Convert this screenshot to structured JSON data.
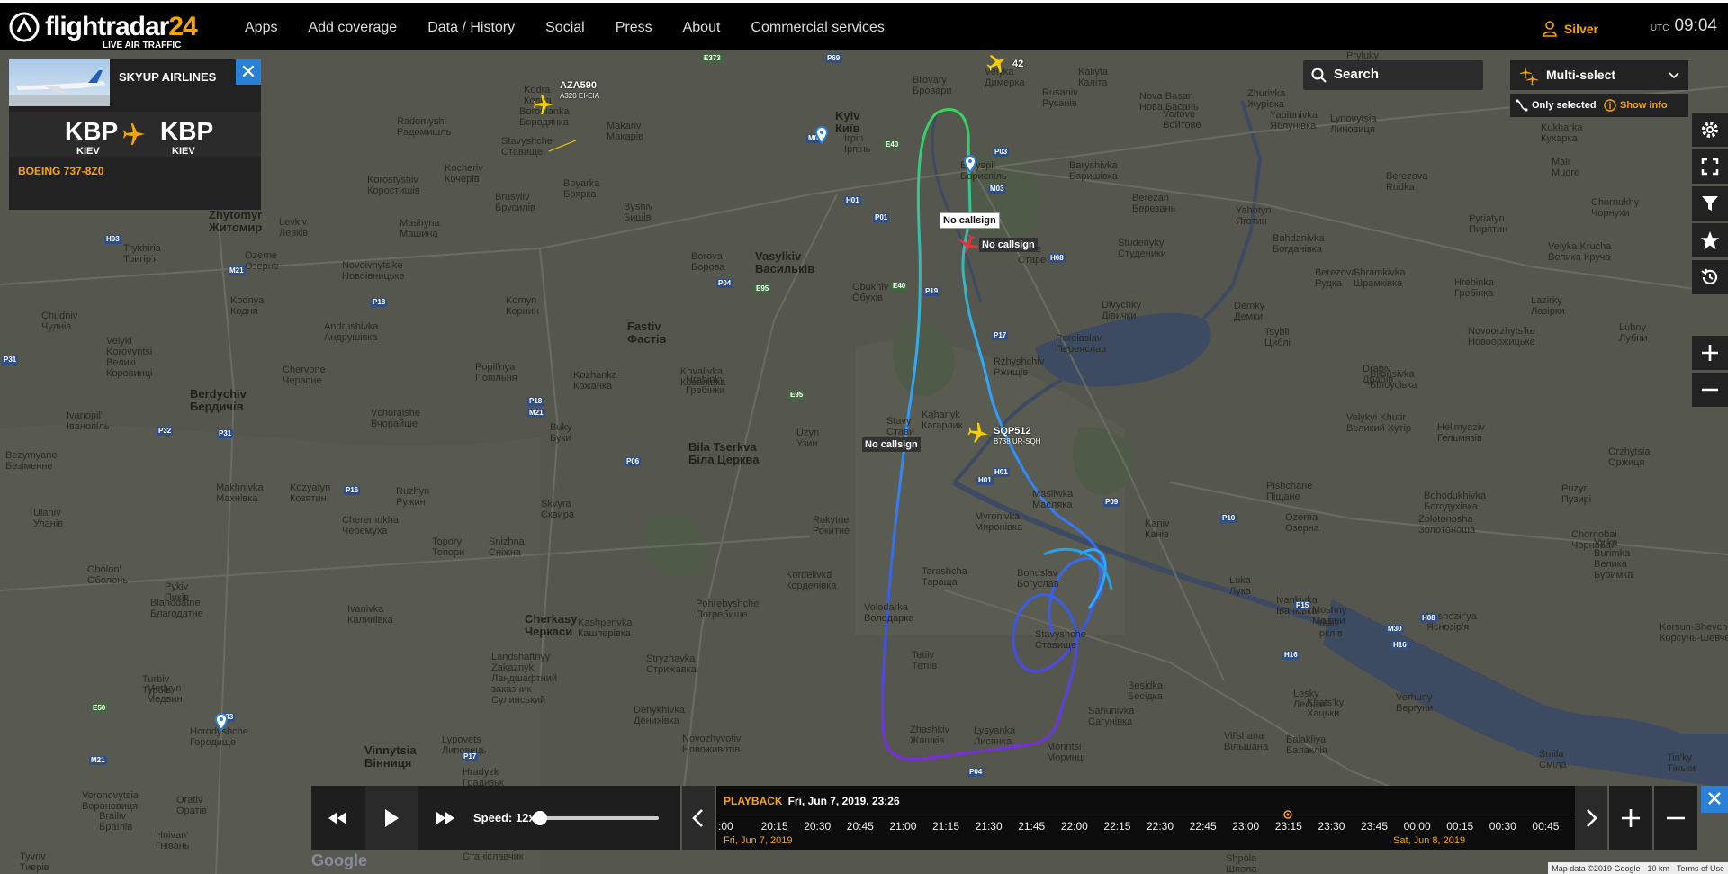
{
  "brand": {
    "name": "flightradar",
    "num": "24",
    "tagline": "LIVE AIR TRAFFIC"
  },
  "nav": [
    "Apps",
    "Add coverage",
    "Data / History",
    "Social",
    "Press",
    "About",
    "Commercial services"
  ],
  "user": {
    "level": "Silver"
  },
  "clock": {
    "zone": "UTC",
    "time": "09:04"
  },
  "flight_panel": {
    "airline": "SKYUP AIRLINES",
    "origin_code": "KBP",
    "origin_city": "KIEV",
    "dest_code": "KBP",
    "dest_city": "KIEV",
    "aircraft": "BOEING 737-8Z0",
    "close": "✕"
  },
  "search": {
    "placeholder": "Search"
  },
  "multiselect": {
    "label": "Multi-select",
    "only_selected": "Only selected",
    "show_info": "Show info"
  },
  "aircraft_labels": [
    {
      "callsign": "AZA590",
      "info": "A320 EI-EIA"
    },
    {
      "callsign": "42",
      "info": ""
    },
    {
      "callsign": "SQP512",
      "info": "B738 UR-SQH"
    }
  ],
  "callsigns": {
    "top_box": "No callsign",
    "selected": "No callsign",
    "left": "No callsign"
  },
  "places": [
    {
      "t": "Kodra\nКодра"
    },
    {
      "t": "Borodianka\nБородянка"
    },
    {
      "t": "Radomyshl\nРадомишль"
    },
    {
      "t": "Makariv\nМакарів"
    },
    {
      "t": "Kyiv\nКиїв"
    },
    {
      "t": "Irpin\nІрпінь"
    },
    {
      "t": "Brovary\nБровари"
    },
    {
      "t": "Velyka\nДимерка"
    },
    {
      "t": "Rusaniv\nРусанів"
    },
    {
      "t": "Kaliyta\nКаліта"
    },
    {
      "t": "Nova Basan\nНова Басань"
    },
    {
      "t": "Zhurivka\nЖурівка"
    },
    {
      "t": "Pryluky\nПрилуки"
    },
    {
      "t": "Stavyshche\nСтавище"
    },
    {
      "t": "Korostyshiv\nКоростишів"
    },
    {
      "t": "Kocheriv\nКочерів"
    },
    {
      "t": "Boryspil\nБориспіль"
    },
    {
      "t": "Baryshivka\nБаришівка"
    },
    {
      "t": "Yablunivka\nЯблунівка"
    },
    {
      "t": "Lynovytsia\nЛиновиця"
    },
    {
      "t": "Voitove\nВойтове"
    },
    {
      "t": "Kukharka\nКухарка"
    },
    {
      "t": "Zhytomyr\nЖитомир"
    },
    {
      "t": "Brusyliv\nБрусилів"
    },
    {
      "t": "Boyarka\nБоярка"
    },
    {
      "t": "Byshiv\nБишів"
    },
    {
      "t": "Levkiv\nЛевків"
    },
    {
      "t": "Mashyna\nМашина"
    },
    {
      "t": "Berezan\nБерезань"
    },
    {
      "t": "Berezova\nRudka"
    },
    {
      "t": "Mali\nMudre"
    },
    {
      "t": "Chornukhy\nЧорнухи"
    },
    {
      "t": "Pyriatyn\nПирятин"
    },
    {
      "t": "Yahotyn\nЯготин"
    },
    {
      "t": "Velyka Krucha\nВелика Круча"
    },
    {
      "t": "Trykhiria\nТригір'я"
    },
    {
      "t": "Ozerne\nОзерне"
    },
    {
      "t": "Novoivnyts'ke\nНовоівницьке"
    },
    {
      "t": "Borova\nБорова"
    },
    {
      "t": "Vasylkiv\nВасильків"
    },
    {
      "t": "Obukhiv\nОбухів"
    },
    {
      "t": "Stare\nСтаре"
    },
    {
      "t": "Studenyky\nСтуденики"
    },
    {
      "t": "Bohdanivka\nБогданівка"
    },
    {
      "t": "Shramkivka\nШрамківка"
    },
    {
      "t": "Hrebinka\nГребінка"
    },
    {
      "t": "Lazirky\nЛазірки"
    },
    {
      "t": "Chudniv\nЧуднів"
    },
    {
      "t": "Kodnya\nКодня"
    },
    {
      "t": "Komyn\nКорнин"
    },
    {
      "t": "Fastiv\nФастів"
    },
    {
      "t": "Divychky\nДівички"
    },
    {
      "t": "Demky\nДемки"
    },
    {
      "t": "Berezova\nРудка"
    },
    {
      "t": "Lubny\nЛубни"
    },
    {
      "t": "Velyki\nKorovyntsi\nВеликі\nКоровинці"
    },
    {
      "t": "Andrushivka\nАндрушівка"
    },
    {
      "t": "Pereiaslav\nПереяслав"
    },
    {
      "t": "Tsybli\nЦиблі"
    },
    {
      "t": "Novoorzhyts'ke\nНовооржицьке"
    },
    {
      "t": "Chervone\nЧервоне"
    },
    {
      "t": "Popil'nya\nПопільня"
    },
    {
      "t": "Kozhanka\nКожанка"
    },
    {
      "t": "Kovalivka\nКовалівка"
    },
    {
      "t": "Hrebinky\nГребінки"
    },
    {
      "t": "Rzhyshchiv\nРжищів"
    },
    {
      "t": "Drabiv\nДрабів"
    },
    {
      "t": "Bilousivka\nБілоусівка"
    },
    {
      "t": "Berdychiv\nБердичів"
    },
    {
      "t": "Ivanopil'\nІванопіль"
    },
    {
      "t": "Vchoraishe\nВчорайше"
    },
    {
      "t": "Buky\nБуки"
    },
    {
      "t": "Uzyn\nУзин"
    },
    {
      "t": "Stavy\nСтави"
    },
    {
      "t": "Kaharlyk\nКагарлик"
    },
    {
      "t": "Bila Tserkva\nБіла Церква"
    },
    {
      "t": "Velykyi Khutir\nВеликий Хутір"
    },
    {
      "t": "Hel'myaziv\nГельмязів"
    },
    {
      "t": "Orzhytsia\nОржиця"
    },
    {
      "t": "Bezymyane\nБезіменне"
    },
    {
      "t": "Makhnivka\nМахнівка"
    },
    {
      "t": "Kozyatyn\nКозятин"
    },
    {
      "t": "Ruzhyn\nРужин"
    },
    {
      "t": "Skvyra\nСквира"
    },
    {
      "t": "Rokytne\nРокитне"
    },
    {
      "t": "Myronivka\nМиронівка"
    },
    {
      "t": "Masliwka\nМасляка"
    },
    {
      "t": "Kaniv\nКанів"
    },
    {
      "t": "Pishchane\nПіщане"
    },
    {
      "t": "Bohodukhivka\nБогодухівка"
    },
    {
      "t": "Puzyri\nПузирі"
    },
    {
      "t": "Ulaniv\nУланів"
    },
    {
      "t": "Cheremukha\nЧеремуха"
    },
    {
      "t": "Topory\nТопори"
    },
    {
      "t": "Snizhna\nСніжна"
    },
    {
      "t": "Ozerna\nОзерна"
    },
    {
      "t": "Zolotonosha\nЗолотоноша"
    },
    {
      "t": "Chornobai\nЧорнобай"
    },
    {
      "t": "Vylka\nBurimka\nВелика\nБуримка"
    },
    {
      "t": "Obolon'\nОболонь"
    },
    {
      "t": "Pykiv\nПиків"
    },
    {
      "t": "Kordelivka\nКорделівка"
    },
    {
      "t": "Tarashcha\nТаращa"
    },
    {
      "t": "Bohuslav\nБогуслав"
    },
    {
      "t": "Ivankivka\nІванківка"
    },
    {
      "t": "Blahodatne\nБлагодатне"
    },
    {
      "t": "Ivanivka\nКалинівка"
    },
    {
      "t": "Pohrebyshche\nПогребище"
    },
    {
      "t": "Volodarka\nВолодарка"
    },
    {
      "t": "Luka\nЛука"
    },
    {
      "t": "Moshny\nМошни"
    },
    {
      "t": "Yasnozir'ya\nЯснозір'я"
    },
    {
      "t": "Irkliiv\nІрклів"
    },
    {
      "t": "Cherkasy\nЧеркаси"
    },
    {
      "t": "Kashperivka\nКашперівка"
    },
    {
      "t": "Stavyshche\nСтавище"
    },
    {
      "t": "Korsun-Shevchenkivs'kyi\nКорсунь-Шевченківський"
    },
    {
      "t": "Landshaftnyy\nZakaznyk\nЛандшафтний\nзаказник\nСулинський"
    },
    {
      "t": "Tetiiv\nТетіїв"
    },
    {
      "t": "Medvyn\nМедвин"
    },
    {
      "t": "Turbiv\nТурбів"
    },
    {
      "t": "Stryzhavka\nСтрижавка"
    },
    {
      "t": "Denykhivka\nДенихівка"
    },
    {
      "t": "Besidka\nБесідка"
    },
    {
      "t": "Lesky\nЛеськи"
    },
    {
      "t": "Khats'ky\nХацьки"
    },
    {
      "t": "Verhuny\nВергуни"
    },
    {
      "t": "Sahunivka\nСагунівка"
    },
    {
      "t": "Horodyshche\nГородище"
    },
    {
      "t": "Vinnytsia\nВінниця"
    },
    {
      "t": "Lypovets\nЛиповець"
    },
    {
      "t": "Novozhyvotiv\nНовоживотів"
    },
    {
      "t": "Zhashkiv\nЖашків"
    },
    {
      "t": "Lysyanka\nЛисянка"
    },
    {
      "t": "Morintsi\nМоринці"
    },
    {
      "t": "Vil'shana\nВільшана"
    },
    {
      "t": "Balakliya\nБалаклія"
    },
    {
      "t": "Smila\nСміла"
    },
    {
      "t": "Tin'ky\nТіньки"
    },
    {
      "t": "Hradyzk\nГрадизьк"
    },
    {
      "t": "Orativ\nОратів"
    },
    {
      "t": "Voronovytsia\nВороновиця"
    },
    {
      "t": "Brailiv\nБраїлів"
    },
    {
      "t": "Hnivan'\nГнівань"
    },
    {
      "t": "Tyvriv\nТиврів"
    },
    {
      "t": "Stanislavchyk\nСтаніславчик"
    },
    {
      "t": "Dashiv\nДашів"
    },
    {
      "t": "Shpola\nШпола"
    },
    {
      "t": "Oleksandrivka\nОлександрівка"
    },
    {
      "t": "Man'kivka\nМаньківка"
    }
  ],
  "roads": [
    "E373",
    "P69",
    "M07",
    "E40",
    "P03",
    "H01",
    "P01",
    "M03",
    "H08",
    "P04",
    "E95",
    "P19",
    "P18",
    "E40",
    "M21",
    "H03",
    "P31",
    "P32",
    "P31",
    "M21",
    "P06",
    "E95",
    "P18",
    "P16",
    "P17",
    "P10",
    "H16",
    "H08",
    "P33",
    "E50",
    "M21",
    "P17",
    "P04",
    "H01",
    "P15",
    "P09",
    "H16",
    "M30",
    "H01"
  ],
  "playback": {
    "speed_label": "Speed: 12x",
    "speed_value": 12,
    "title": "PLAYBACK",
    "datetime": "Fri, Jun 7, 2019, 23:26",
    "ticks": [
      ":00",
      "20:15",
      "20:30",
      "20:45",
      "21:00",
      "21:15",
      "21:30",
      "21:45",
      "22:00",
      "22:15",
      "22:30",
      "22:45",
      "23:00",
      "23:15",
      "23:30",
      "23:45",
      "00:00",
      "00:15",
      "00:30",
      "00:45",
      "0"
    ],
    "day1": "Fri, Jun 7, 2019",
    "day2": "Sat, Jun 8, 2019"
  },
  "attribution": {
    "map_data": "Map data ©2019 Google",
    "scale": "10 km",
    "terms": "Terms of Use"
  },
  "google": "Google",
  "colors": {
    "accent": "#f7a600",
    "blue": "#2a7fd6",
    "track_start": "#38d35c",
    "track_end": "#7a2be0"
  }
}
